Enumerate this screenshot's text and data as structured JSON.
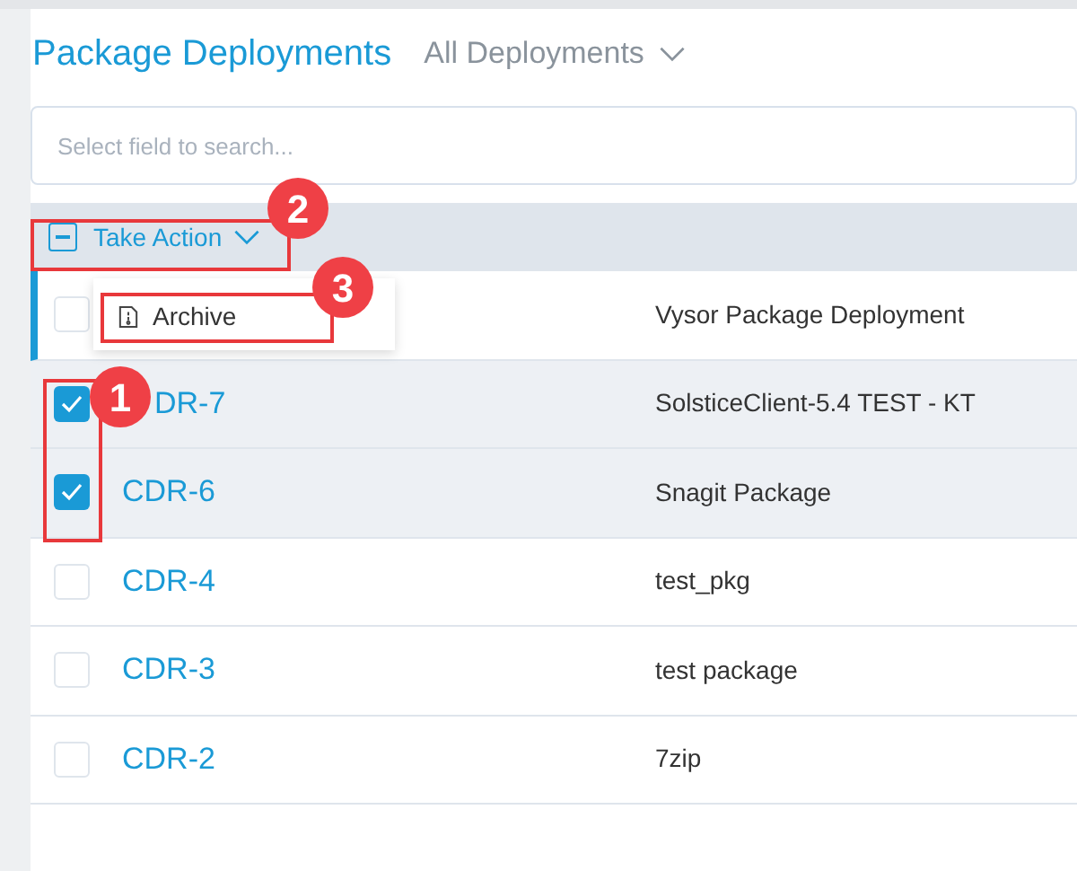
{
  "page": {
    "title": "Package Deployments",
    "view_selector": "All Deployments"
  },
  "search": {
    "placeholder": "Select field to search..."
  },
  "bulk_action": {
    "label": "Take Action",
    "partially_checked": true
  },
  "action_menu": {
    "items": [
      {
        "label": "Archive"
      }
    ]
  },
  "rows": [
    {
      "name": "Vysor Package Deployment",
      "checked": false,
      "highlighted": true
    },
    {
      "id": "DR-7",
      "id_cut_off": true,
      "name": "SolsticeClient-5.4 TEST - KT",
      "checked": true,
      "highlighted": false
    },
    {
      "id": "CDR-6",
      "name": "Snagit Package",
      "checked": true,
      "highlighted": false
    },
    {
      "id": "CDR-4",
      "name": "test_pkg",
      "checked": false,
      "highlighted": false
    },
    {
      "id": "CDR-3",
      "name": "test package",
      "checked": false,
      "highlighted": false
    },
    {
      "id": "CDR-2",
      "name": "7zip",
      "checked": false,
      "highlighted": false
    }
  ],
  "annotations": [
    {
      "label": "1"
    },
    {
      "label": "2"
    },
    {
      "label": "3"
    }
  ]
}
